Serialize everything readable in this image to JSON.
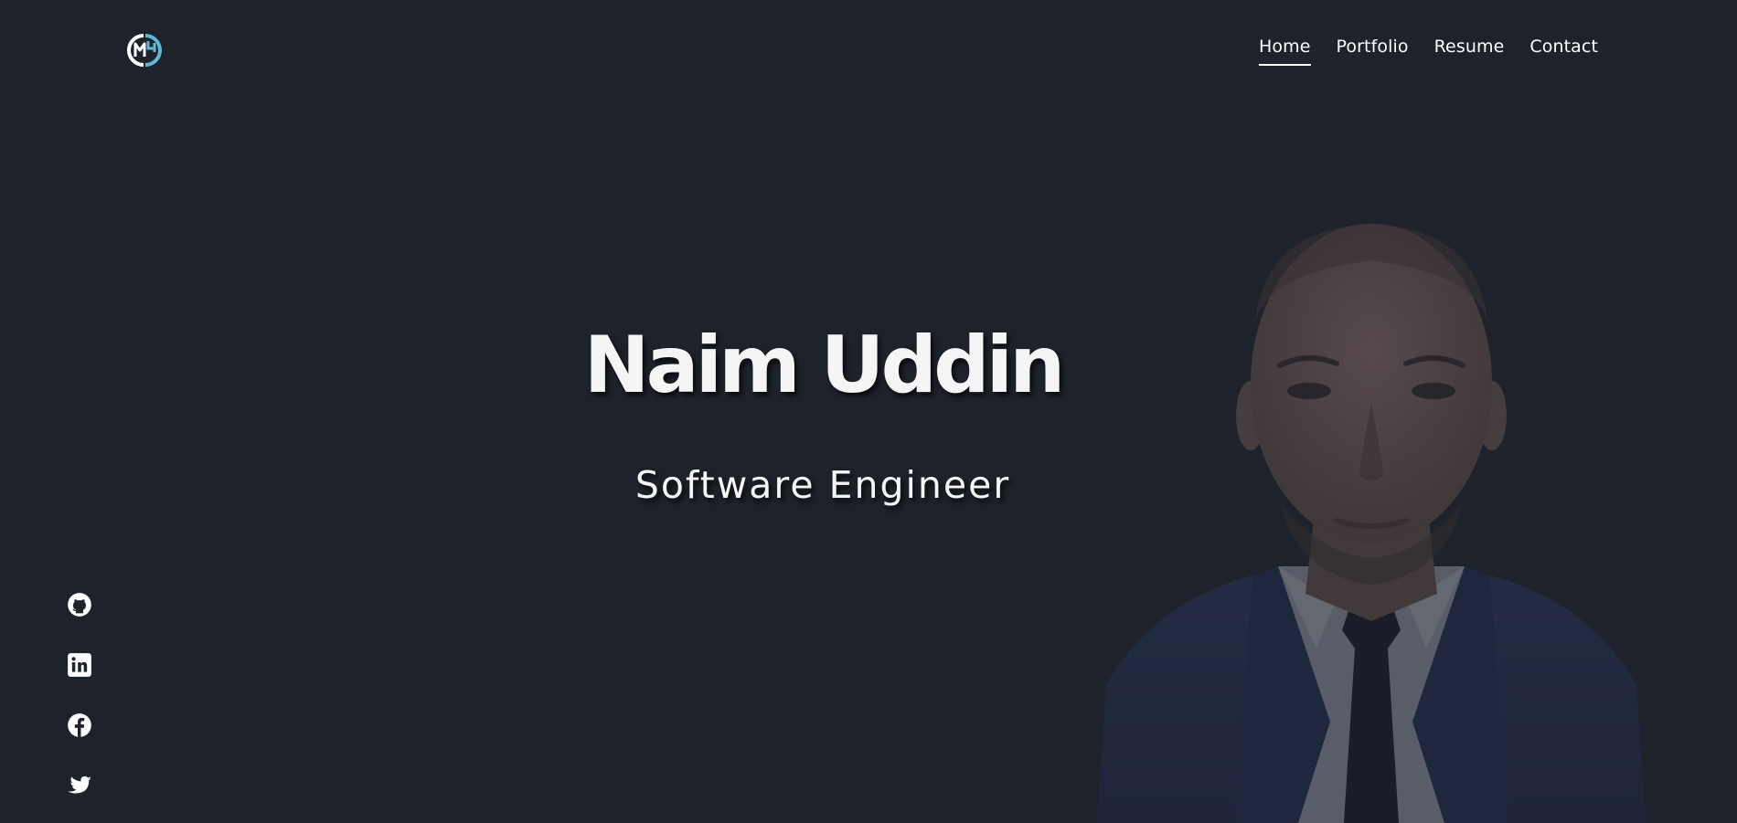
{
  "header": {
    "logo_icon": "ms-monogram-logo",
    "nav": [
      {
        "label": "Home",
        "active": true
      },
      {
        "label": "Portfolio",
        "active": false
      },
      {
        "label": "Resume",
        "active": false
      },
      {
        "label": "Contact",
        "active": false
      }
    ]
  },
  "hero": {
    "name": "Naim Uddin",
    "title": "Software Engineer",
    "photo_icon": "profile-portrait"
  },
  "social": [
    {
      "icon": "github-icon"
    },
    {
      "icon": "linkedin-icon"
    },
    {
      "icon": "facebook-icon"
    },
    {
      "icon": "twitter-icon"
    }
  ],
  "colors": {
    "background": "#1e222b",
    "text": "#f5f5f5",
    "logo_accent": "#5fb6d6"
  }
}
